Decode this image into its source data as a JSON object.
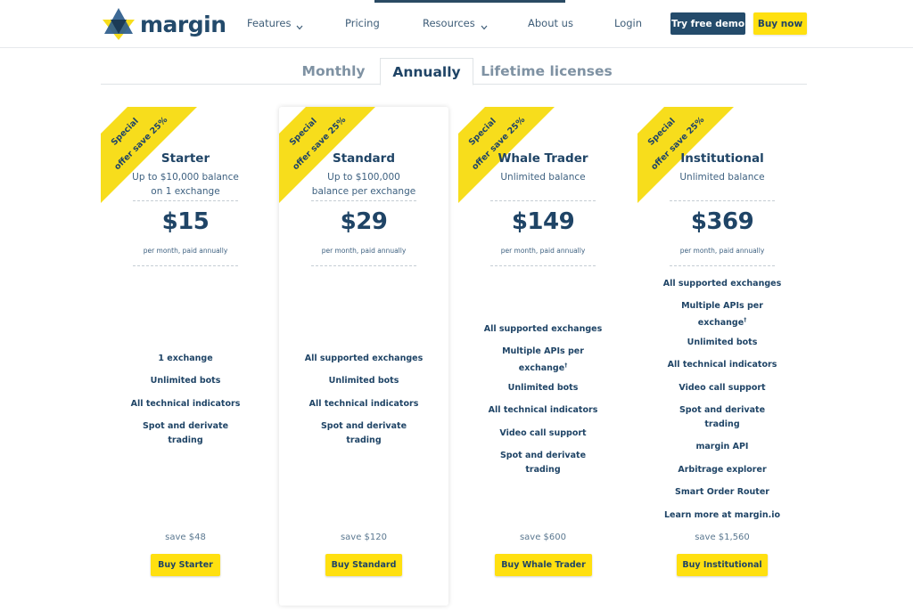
{
  "brand": {
    "name": "margin",
    "colors": {
      "navy": "#244b6b",
      "yellow": "#ffe010",
      "ribbon": "#f7dd1c",
      "logo_blue": "#2c5c8c"
    }
  },
  "nav": {
    "features": "Features",
    "pricing": "Pricing",
    "resources": "Resources",
    "about": "About us",
    "login": "Login",
    "demo_button": "Try free demo",
    "buy_button": "Buy now"
  },
  "tabs": [
    {
      "label": "Monthly",
      "active": false
    },
    {
      "label": "Annually",
      "active": true
    },
    {
      "label": "Lifetime licenses",
      "active": false
    }
  ],
  "ribbon": {
    "line1": "Special",
    "line2": "offer save 25%"
  },
  "price_note": "per month, paid annually",
  "plans": [
    {
      "name": "Starter",
      "desc": "Up to $10,000 balance on 1 exchange",
      "price": "$15",
      "features": [
        "1 exchange",
        "Unlimited bots",
        "All technical indicators",
        "Spot and derivate trading"
      ],
      "save": "save $48",
      "button": "Buy Starter"
    },
    {
      "name": "Standard",
      "desc": "Up to $100,000 balance per exchange",
      "price": "$29",
      "features": [
        "All supported exchanges",
        "Unlimited bots",
        "All technical indicators",
        "Spot and derivate trading"
      ],
      "save": "save $120",
      "button": "Buy Standard"
    },
    {
      "name": "Whale Trader",
      "desc": "Unlimited balance",
      "price": "$149",
      "features": [
        "All supported exchanges",
        "Multiple APIs per exchange",
        "Unlimited bots",
        "All technical indicators",
        "Video call support",
        "Spot and derivate trading"
      ],
      "save": "save $600",
      "button": "Buy Whale Trader"
    },
    {
      "name": "Institutional",
      "desc": "Unlimited balance",
      "price": "$369",
      "features": [
        "All supported exchanges",
        "Multiple APIs per exchange",
        "Unlimited bots",
        "All technical indicators",
        "Video call support",
        "Spot and derivate trading",
        "margin API",
        "Arbitrage explorer",
        "Smart Order Router",
        "Learn more at margin.io"
      ],
      "save": "save $1,560",
      "button": "Buy Institutional"
    }
  ]
}
